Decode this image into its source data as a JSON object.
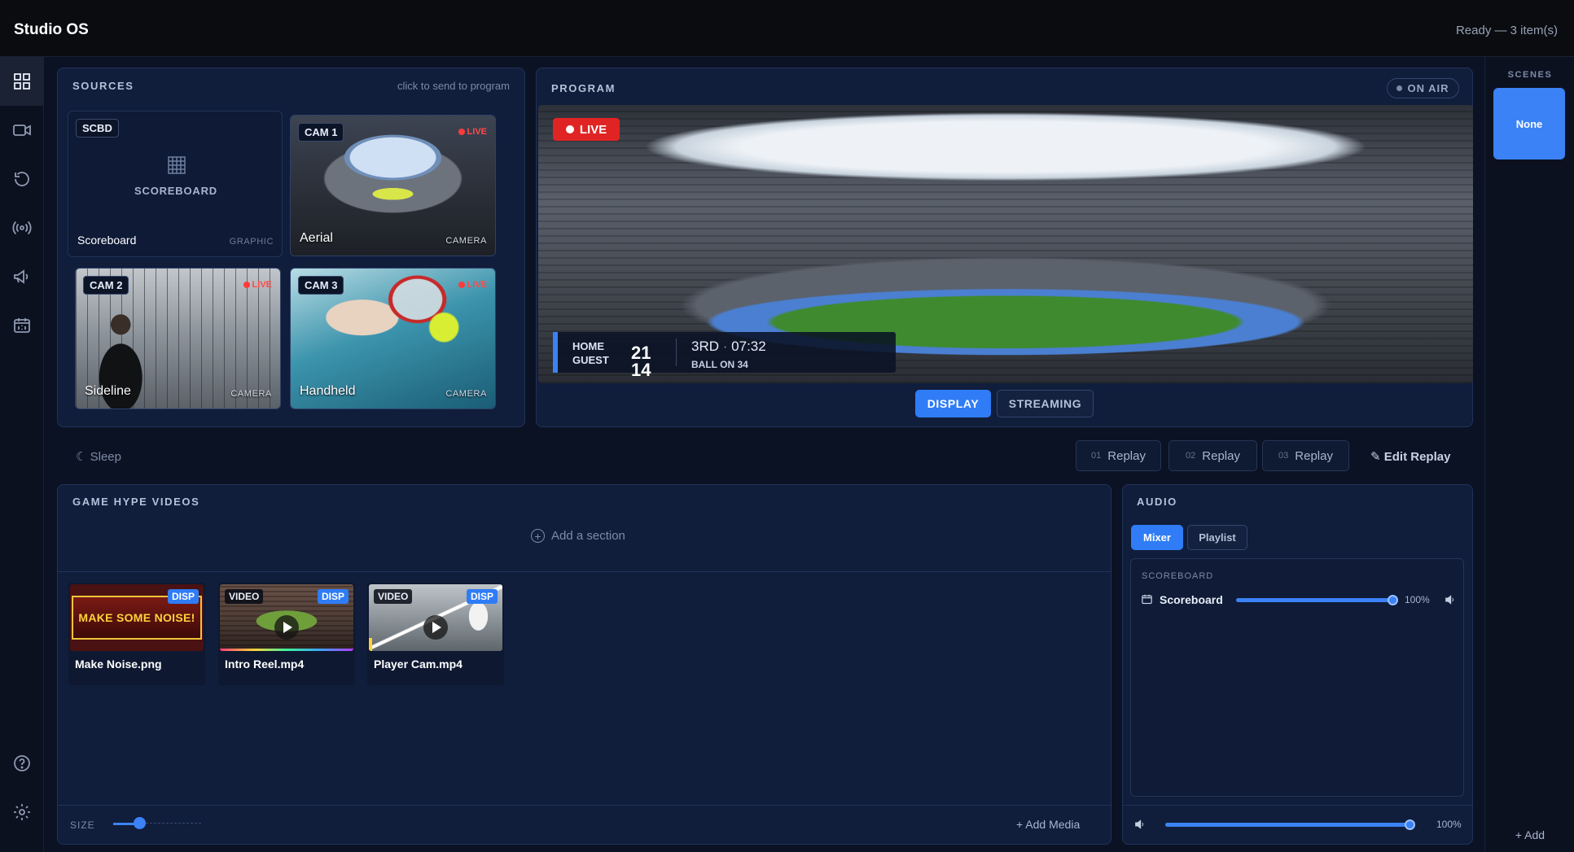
{
  "app": {
    "title": "Studio OS",
    "status": "Ready — 3 item(s)"
  },
  "rail": {
    "items": [
      {
        "icon": "grid-icon",
        "active": true
      },
      {
        "icon": "video-camera-icon",
        "active": false
      },
      {
        "icon": "replay-icon",
        "active": false
      },
      {
        "icon": "broadcast-icon",
        "active": false
      },
      {
        "icon": "megaphone-icon",
        "active": false
      },
      {
        "icon": "scoreboard-icon",
        "active": false
      }
    ],
    "bottom": [
      "help-icon",
      "gear-icon",
      "user-icon"
    ]
  },
  "sources": {
    "title": "SOURCES",
    "hint": "click to send to program",
    "tiles": [
      {
        "tag": "SCBD",
        "center_label": "SCOREBOARD",
        "name": "Scoreboard",
        "kind": "GRAPHIC",
        "live": ""
      },
      {
        "tag": "CAM 1",
        "name": "Aerial",
        "kind": "CAMERA",
        "live": "LIVE"
      },
      {
        "tag": "CAM 2",
        "name": "Sideline",
        "kind": "CAMERA",
        "live": "LIVE"
      },
      {
        "tag": "CAM 3",
        "name": "Handheld",
        "kind": "CAMERA",
        "live": "LIVE"
      }
    ]
  },
  "program": {
    "title": "PROGRAM",
    "on_air": "ON AIR",
    "live": "LIVE",
    "score": {
      "home": "HOME",
      "guest": "GUEST",
      "home_score": "21",
      "guest_score": "14",
      "period": "3RD",
      "dot": "·",
      "clock": "07:32",
      "down": "BALL ON 34"
    },
    "outputs": [
      "DISPLAY",
      "STREAMING"
    ]
  },
  "scenes": {
    "title": "SCENES",
    "items": [
      "None"
    ],
    "add": "+ Add"
  },
  "toolbar": {
    "sleep": "☾ Sleep",
    "replays": [
      {
        "num": "01",
        "label": "Replay"
      },
      {
        "num": "02",
        "label": "Replay"
      },
      {
        "num": "03",
        "label": "Replay"
      }
    ],
    "edit_replay": "✎ Edit Replay"
  },
  "hype": {
    "title": "GAME HYPE VIDEOS",
    "add_section": "Add a section",
    "media": [
      {
        "name": "Make Noise.png",
        "type": "",
        "badge": "DISP",
        "art_text": "MAKE SOME NOISE!"
      },
      {
        "name": "Intro Reel.mp4",
        "type": "VIDEO",
        "badge": "DISP"
      },
      {
        "name": "Player Cam.mp4",
        "type": "VIDEO",
        "badge": "DISP"
      }
    ],
    "size_label": "SIZE",
    "size_value": 0.3,
    "add_media": "+ Add Media"
  },
  "audio": {
    "title": "AUDIO",
    "tabs": [
      "Mixer",
      "Playlist"
    ],
    "group": "SCOREBOARD",
    "channel": {
      "name": "Scoreboard",
      "level": 100,
      "level_text": "100%"
    },
    "master": {
      "level": 100,
      "level_text": "100%"
    }
  },
  "colors": {
    "accent": "#2f7cf6",
    "live": "#e02424",
    "background": "#0b1224",
    "panel": "#101d3b"
  }
}
